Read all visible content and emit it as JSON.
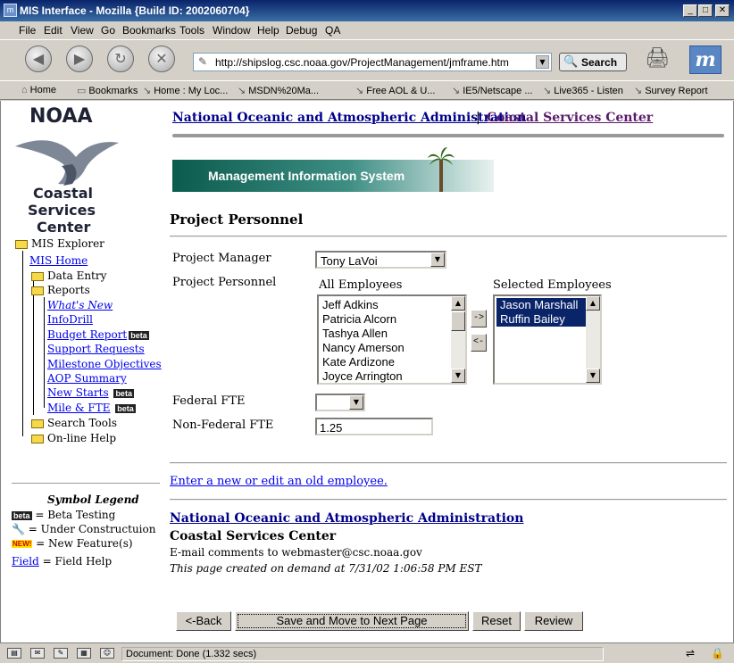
{
  "window": {
    "title": "MIS Interface - Mozilla {Build ID: 2002060704}"
  },
  "menu": [
    "File",
    "Edit",
    "View",
    "Go",
    "Bookmarks",
    "Tools",
    "Window",
    "Help",
    "Debug",
    "QA"
  ],
  "navbar": {
    "url": "http://shipslog.csc.noaa.gov/ProjectManagement/jmframe.htm",
    "search_label": "Search"
  },
  "bookmarks": [
    "Home",
    "Bookmarks",
    "Home : My Loc...",
    "MSDN%20Ma...",
    "Free AOL & U...",
    "IE5/Netscape ...",
    "Live365 - Listen",
    "Survey Report"
  ],
  "sidebar": {
    "logo_top": "NOAA",
    "logo_lines": [
      "Coastal",
      "Services",
      "Center"
    ],
    "tree_root": "MIS Explorer",
    "mis_home": "MIS Home",
    "data_entry": "Data Entry",
    "reports": "Reports",
    "report_items": [
      "What's New",
      "InfoDrill",
      "Budget Report",
      "Support Requests",
      "Milestone Objectives",
      "AOP Summary",
      "New Starts",
      "Mile & FTE"
    ],
    "search_tools": "Search Tools",
    "online_help": "On-line Help",
    "beta_badge": "beta",
    "legend": {
      "title": "Symbol Legend",
      "beta": "= Beta Testing",
      "construction": "= Under Constructuion",
      "new_badge": "NEW!",
      "new": "= New Feature(s)",
      "field_link": "Field",
      "field": "= Field Help"
    }
  },
  "header": {
    "noaa_link": "National Oceanic and Atmospheric Administration",
    "separator": "|",
    "csc_link": "Coastal Services Center",
    "banner": "Management Information System"
  },
  "form": {
    "page_title": "Project Personnel",
    "project_manager_label": "Project Manager",
    "project_manager_value": "Tony LaVoi",
    "project_personnel_label": "Project Personnel",
    "all_employees_label": "All Employees",
    "all_employees": [
      "Jeff Adkins",
      "Patricia Alcorn",
      "Tashya Allen",
      "Nancy Amerson",
      "Kate Ardizone",
      "Joyce Arrington"
    ],
    "add_btn": "->",
    "remove_btn": "<-",
    "selected_employees_label": "Selected Employees",
    "selected_employees": [
      "Jason Marshall",
      "Ruffin Bailey"
    ],
    "federal_fte_label": "Federal FTE",
    "federal_fte_value": "",
    "nonfederal_fte_label": "Non-Federal FTE",
    "nonfederal_fte_value": "1.25",
    "employee_link": "Enter a new or edit an old employee."
  },
  "footer": {
    "noaa_link": "National Oceanic and Atmospheric Administration",
    "csc": "Coastal Services Center",
    "mail": "E-mail comments to webmaster@csc.noaa.gov",
    "created": "This page created on demand at 7/31/02 1:06:58 PM EST"
  },
  "buttons": {
    "back": "<-Back",
    "save": "Save and Move to Next Page",
    "reset": "Reset",
    "review": "Review"
  },
  "status": {
    "text": "Document: Done (1.332 secs)"
  }
}
